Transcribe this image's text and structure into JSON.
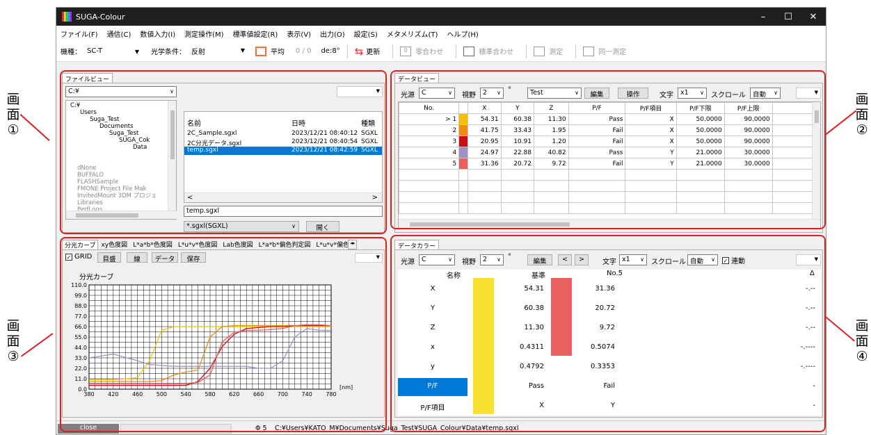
{
  "app": {
    "title": "SUGA-Colour",
    "min": "–",
    "max": "☐",
    "close": "✕"
  },
  "menu": [
    "ファイル(F)",
    "通信(C)",
    "数値入力(I)",
    "測定操作(M)",
    "標準値設定(R)",
    "表示(V)",
    "出力(O)",
    "設定(S)",
    "メタメリズム(T)",
    "ヘルプ(H)"
  ],
  "toolbar": {
    "model_label": "機種：",
    "model_value": "SC-T",
    "optical_label": "光学条件：",
    "optical_value": "反射",
    "average_label": "平均",
    "average_count": "0 / 0",
    "de_value": "de:8°",
    "refresh_label": "更新",
    "zero_label": "零合わせ",
    "standard_label": "標準合わせ",
    "measure_label": "測定",
    "same_measure_label": "同一測定"
  },
  "labels": {
    "p1": [
      "画",
      "面",
      "①"
    ],
    "p2": [
      "画",
      "面",
      "②"
    ],
    "p3": [
      "画",
      "面",
      "③"
    ],
    "p4": [
      "画",
      "面",
      "④"
    ]
  },
  "fileview": {
    "tab": "ファイルビュー",
    "drive": "C:¥",
    "tree": [
      "C:¥",
      "Users",
      "Suga_Test",
      "Documents",
      "Suga_Test",
      "SUGA_Cok",
      "Data",
      "dNone",
      "BUFFALO",
      "FLASHSample",
      "FMONE Project File Mak",
      "InvitedMount 3DM プロジェ",
      "Libraries",
      "PerfLogs"
    ],
    "list_headers": [
      "名前",
      "日時",
      "種類"
    ],
    "files": [
      {
        "name": "2C_Sample.sgxl",
        "date": "2023/12/21 08:40:12",
        "type": "SGXL"
      },
      {
        "name": "2C分光データ.sgxl",
        "date": "2023/12/21 08:40:54",
        "type": "SGXL"
      },
      {
        "name": "temp.sgxl",
        "date": "2023/12/21 08:42:59",
        "type": "SGXL"
      }
    ],
    "filename": "temp.sgxl",
    "filter": "*.sgxl(SGXL)",
    "open_button": "開く"
  },
  "dataview": {
    "tab": "データビュー",
    "light_label": "光源",
    "light": "C",
    "view_label": "視野",
    "view": "2",
    "deg": "°",
    "set": "Test",
    "edit": "編集",
    "operate": "操作",
    "text_label": "文字",
    "text": "x1",
    "scroll_label": "スクロール",
    "scroll": "自動",
    "headers": [
      "No.",
      "X",
      "Y",
      "Z",
      "P/F",
      "P/F項目",
      "P/F下限",
      "P/F上限"
    ],
    "rows": [
      {
        "no": "> 1",
        "color": "#f5c000",
        "x": "54.31",
        "y": "60.38",
        "z": "11.30",
        "pf": "Pass",
        "item": "X",
        "lo": "50.0000",
        "hi": "90.0000"
      },
      {
        "no": "2",
        "color": "#f08a10",
        "x": "41.75",
        "y": "33.43",
        "z": "1.95",
        "pf": "Fail",
        "item": "X",
        "lo": "50.0000",
        "hi": "90.0000"
      },
      {
        "no": "3",
        "color": "#c81010",
        "x": "20.95",
        "y": "10.91",
        "z": "1.20",
        "pf": "Fail",
        "item": "X",
        "lo": "50.0000",
        "hi": "90.0000"
      },
      {
        "no": "4",
        "color": "#a090c8",
        "x": "24.97",
        "y": "22.88",
        "z": "40.82",
        "pf": "Pass",
        "item": "Y",
        "lo": "21.0000",
        "hi": "30.0000"
      },
      {
        "no": "5",
        "color": "#e86060",
        "x": "31.36",
        "y": "20.72",
        "z": "9.72",
        "pf": "Fail",
        "item": "Y",
        "lo": "21.0000",
        "hi": "30.0000"
      }
    ]
  },
  "charts": {
    "tabs": [
      "分光カーブ",
      "xy色度図",
      "L*a*b*色度図",
      "L*u*v*色度図",
      "Lab色度図",
      "L*a*b*偏色判定図",
      "L*u*v*偏色"
    ],
    "grid_label": "GRID",
    "buttons": [
      "目盛",
      "線",
      "データ",
      "保存"
    ]
  },
  "chart_data": {
    "type": "line",
    "title": "分光カーブ",
    "xlabel": "[nm]",
    "ylabel": "",
    "xlim": [
      380,
      780
    ],
    "ylim": [
      0,
      110
    ],
    "x_ticks": [
      "380",
      "420",
      "460",
      "500",
      "540",
      "580",
      "620",
      "660",
      "700",
      "740",
      "780"
    ],
    "y_ticks": [
      "110.0",
      "99.0",
      "88.0",
      "77.0",
      "66.0",
      "55.0",
      "44.0",
      "33.0",
      "22.0",
      "11.0",
      "0.0"
    ],
    "x": [
      380,
      420,
      460,
      480,
      500,
      520,
      540,
      560,
      580,
      600,
      620,
      640,
      660,
      680,
      700,
      720,
      740,
      760,
      780
    ],
    "series": [
      {
        "color": "#f5c000",
        "values": [
          10,
          10,
          12,
          30,
          62,
          66,
          66,
          66,
          66,
          66,
          66,
          66,
          66,
          66,
          66,
          66,
          66,
          66,
          66
        ]
      },
      {
        "color": "#f08a10",
        "values": [
          8,
          8,
          8,
          8,
          9,
          15,
          18,
          20,
          55,
          66,
          67,
          67,
          67,
          67,
          67,
          67,
          67,
          67,
          67
        ]
      },
      {
        "color": "#c81010",
        "values": [
          4,
          4,
          4,
          4,
          4,
          4,
          4,
          8,
          22,
          45,
          58,
          64,
          65,
          66,
          66,
          67,
          67,
          67,
          67
        ]
      },
      {
        "color": "#a090c8",
        "values": [
          33,
          37,
          30,
          26,
          25,
          24,
          24,
          24,
          24,
          24,
          24,
          24,
          22,
          22,
          30,
          55,
          64,
          62,
          62
        ]
      },
      {
        "color": "#e86060",
        "values": [
          6,
          6,
          6,
          6,
          6,
          6,
          6,
          7,
          15,
          50,
          60,
          62,
          62,
          63,
          64,
          67,
          68,
          68,
          67
        ]
      }
    ]
  },
  "datacolor": {
    "tab": "データカラー",
    "light_label": "光源",
    "light": "C",
    "view_label": "視野",
    "view": "2",
    "deg": "°",
    "edit": "編集",
    "prev": "<",
    "next": ">",
    "text_label": "文字",
    "text": "x1",
    "scroll_label": "スクロール",
    "scroll": "自動",
    "link_label": "連動",
    "headers": [
      "名称",
      "基準",
      "No.5",
      "Δ"
    ],
    "std_color": "#f8e030",
    "smp_color": "#e86060",
    "rows": [
      {
        "name": "X",
        "std": "54.31",
        "smp": "31.36",
        "d": "-.--"
      },
      {
        "name": "Y",
        "std": "60.38",
        "smp": "20.72",
        "d": "-.--"
      },
      {
        "name": "Z",
        "std": "11.30",
        "smp": "9.72",
        "d": "-.--"
      },
      {
        "name": "x",
        "std": "0.4311",
        "smp": "0.5074",
        "d": "-.----"
      },
      {
        "name": "y",
        "std": "0.4792",
        "smp": "0.3353",
        "d": "-.----"
      },
      {
        "name": "P/F",
        "std": "Pass",
        "smp": "Fail",
        "d": "-"
      },
      {
        "name": "P/F項目",
        "std": "X",
        "smp": "Y",
        "d": "-"
      }
    ]
  },
  "status": {
    "close": "close",
    "count": "Φ 5",
    "path": "C:¥Users¥KATO_M¥Documents¥Suga_Test¥SUGA_Colour¥Data¥temp.sgxl"
  }
}
